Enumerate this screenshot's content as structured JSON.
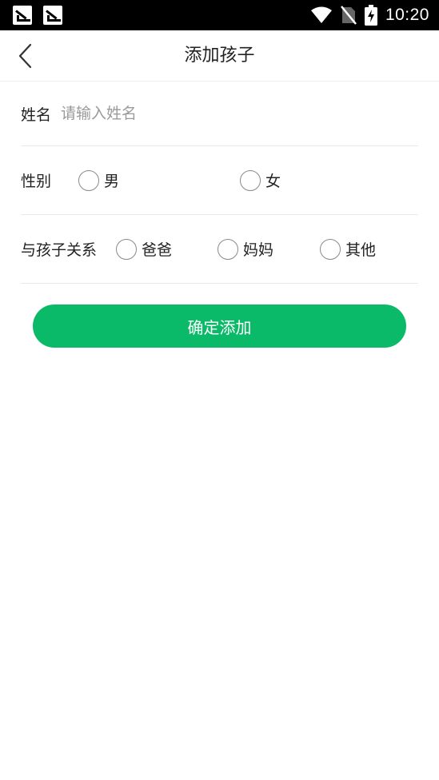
{
  "status_bar": {
    "time": "10:20",
    "icons": [
      "notification-icon",
      "notification-icon",
      "wifi-icon",
      "no-sim-icon",
      "battery-charging-icon"
    ]
  },
  "header": {
    "title": "添加孩子",
    "back_icon": "chevron-left-icon"
  },
  "form": {
    "name": {
      "label": "姓名",
      "value": "",
      "placeholder": "请输入姓名"
    },
    "gender": {
      "label": "性别",
      "options": [
        "男",
        "女"
      ],
      "selected": null
    },
    "relation": {
      "label": "与孩子关系",
      "options": [
        "爸爸",
        "妈妈",
        "其他"
      ],
      "selected": null
    }
  },
  "submit": {
    "label": "确定添加"
  },
  "colors": {
    "accent": "#0bba69",
    "status_bar": "#000000",
    "divider": "#e9e9e9"
  }
}
